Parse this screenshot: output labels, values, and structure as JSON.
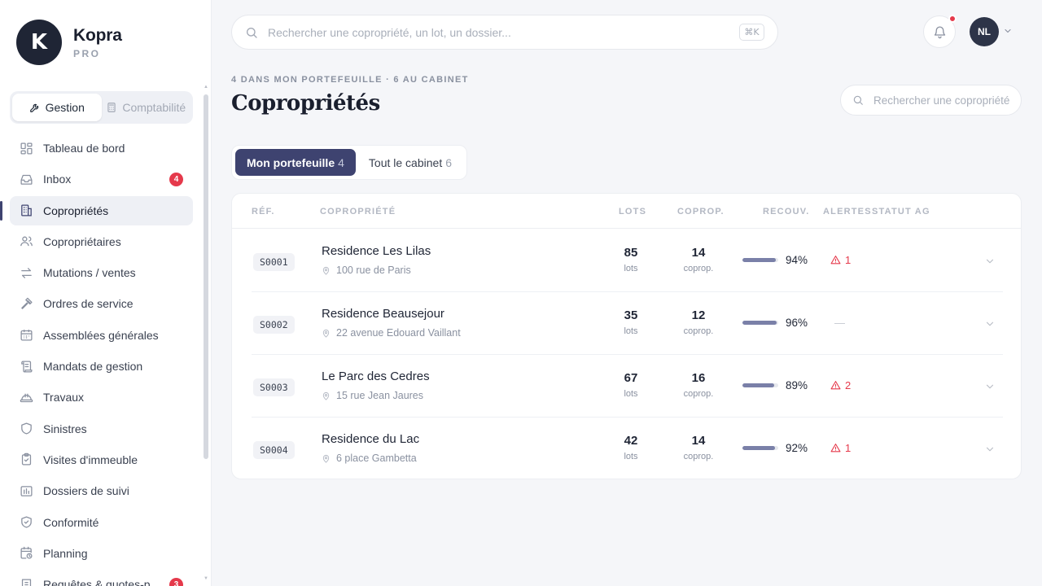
{
  "brand": {
    "letter": "K",
    "name": "Kopra",
    "sub": "PRO"
  },
  "mode": {
    "gestion": "Gestion",
    "comptabilite": "Comptabilité"
  },
  "nav": [
    {
      "label": "Tableau de bord",
      "icon": "dashboard-icon"
    },
    {
      "label": "Inbox",
      "icon": "inbox-icon",
      "badge": "4"
    },
    {
      "label": "Copropriétés",
      "icon": "building-icon",
      "active": true
    },
    {
      "label": "Copropriétaires",
      "icon": "users-icon"
    },
    {
      "label": "Mutations / ventes",
      "icon": "transfer-icon"
    },
    {
      "label": "Ordres de service",
      "icon": "hammer-icon"
    },
    {
      "label": "Assemblées générales",
      "icon": "calendar-icon"
    },
    {
      "label": "Mandats de gestion",
      "icon": "scroll-icon"
    },
    {
      "label": "Travaux",
      "icon": "helmet-icon"
    },
    {
      "label": "Sinistres",
      "icon": "shield-icon"
    },
    {
      "label": "Visites d'immeuble",
      "icon": "clipboard-check-icon"
    },
    {
      "label": "Dossiers de suivi",
      "icon": "folder-chart-icon"
    },
    {
      "label": "Conformité",
      "icon": "shield-check-icon"
    },
    {
      "label": "Planning",
      "icon": "calendar-clock-icon"
    },
    {
      "label": "Requêtes & quotes-p",
      "icon": "receipt-icon",
      "badge": "3"
    }
  ],
  "search": {
    "placeholder": "Rechercher une copropriété, un lot, un dossier...",
    "shortcut": "⌘K"
  },
  "user": {
    "initials": "NL"
  },
  "header": {
    "eyebrow": "4 DANS MON PORTEFEUILLE · 6 AU CABINET",
    "title": "Copropriétés",
    "search_placeholder": "Rechercher une copropriété"
  },
  "tabs": [
    {
      "label": "Mon portefeuille",
      "count": "4",
      "active": true
    },
    {
      "label": "Tout le cabinet",
      "count": "6"
    }
  ],
  "table": {
    "headers": {
      "ref": "RÉF.",
      "name": "COPROPRIÉTÉ",
      "lots": "LOTS",
      "coprop": "COPROP.",
      "recouv": "RECOUV.",
      "alertes": "ALERTES",
      "statut": "STATUT AG"
    },
    "lots_unit": "lots",
    "coprop_unit": "coprop.",
    "rows": [
      {
        "ref": "S0001",
        "name": "Residence Les Lilas",
        "address": "100 rue de Paris",
        "lots": "85",
        "coprop": "14",
        "recouv": "94%",
        "recouv_value": 94,
        "alerts": "1"
      },
      {
        "ref": "S0002",
        "name": "Residence Beausejour",
        "address": "22 avenue Edouard Vaillant",
        "lots": "35",
        "coprop": "12",
        "recouv": "96%",
        "recouv_value": 96,
        "alerts": "—"
      },
      {
        "ref": "S0003",
        "name": "Le Parc des Cedres",
        "address": "15 rue Jean Jaures",
        "lots": "67",
        "coprop": "16",
        "recouv": "89%",
        "recouv_value": 89,
        "alerts": "2"
      },
      {
        "ref": "S0004",
        "name": "Residence du Lac",
        "address": "6 place Gambetta",
        "lots": "42",
        "coprop": "14",
        "recouv": "92%",
        "recouv_value": 92,
        "alerts": "1"
      }
    ]
  },
  "colors": {
    "accent": "#3e4370",
    "alert": "#e5394b",
    "bar": "#7a80a8"
  }
}
